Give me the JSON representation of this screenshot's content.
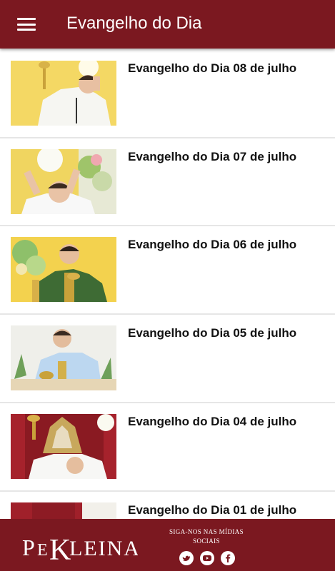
{
  "header": {
    "title": "Evangelho do Dia"
  },
  "items": [
    {
      "title": "Evangelho do Dia 08 de julho"
    },
    {
      "title": "Evangelho do Dia 07 de julho"
    },
    {
      "title": "Evangelho do Dia 06 de julho"
    },
    {
      "title": "Evangelho do Dia 05 de julho"
    },
    {
      "title": "Evangelho do Dia 04 de julho"
    },
    {
      "title": "Evangelho do Dia 01 de julho"
    }
  ],
  "footer": {
    "brand": "PeKleina",
    "social_heading_1": "SIGA-NOS NAS MÍDIAS",
    "social_heading_2": "SOCIAIS",
    "social_icons": [
      "twitter-icon",
      "youtube-icon",
      "facebook-icon"
    ]
  },
  "colors": {
    "primary": "#7b1820",
    "divider": "#e6e6e6"
  }
}
